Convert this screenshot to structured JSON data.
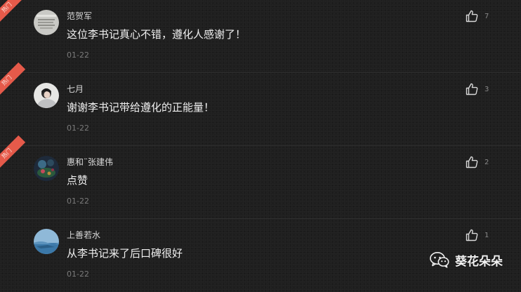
{
  "hot_label": "热门",
  "comments": [
    {
      "username": "范贺军",
      "content": "这位李书记真心不错，遵化人感谢了！",
      "date": "01-22",
      "likes": "7",
      "hot": true
    },
    {
      "username": "七月",
      "content": "谢谢李书记带给遵化的正能量！",
      "date": "01-22",
      "likes": "3",
      "hot": true
    },
    {
      "username": "惠和¨张建伟",
      "content": "点赞",
      "date": "01-22",
      "likes": "2",
      "hot": true
    },
    {
      "username": "上善若水",
      "content": "从李书记来了后口碑很好",
      "date": "01-22",
      "likes": "1",
      "hot": false
    }
  ],
  "watermark": {
    "text": "葵花朵朵"
  },
  "icons": {
    "like": "thumbs-up-icon",
    "watermark": "wechat-icon"
  },
  "colors": {
    "background": "#1f1f1f",
    "hot_ribbon": "#e55a4a",
    "text": "#efefef",
    "muted": "#7b7b7b"
  }
}
